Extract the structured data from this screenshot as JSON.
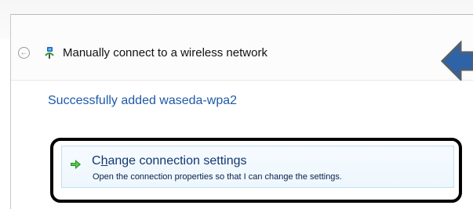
{
  "window": {
    "title": "Manually connect to a wireless network"
  },
  "icons": {
    "back": "back-arrow-icon",
    "network": "wireless-network-icon",
    "pointer": "blue-arrow-icon",
    "command": "green-arrow-icon"
  },
  "content": {
    "success_message": "Successfully added waseda-wpa2"
  },
  "command_link": {
    "title_prefix": "C",
    "title_mnemonic": "h",
    "title_suffix": "ange connection settings",
    "description": "Open the connection properties so that I can change the settings."
  },
  "colors": {
    "success_text": "#1e5aa7",
    "link_title": "#12376f",
    "highlight_border": "#000000",
    "pointer_arrow": "#2f63a7",
    "command_arrow": "#2f8a2f"
  }
}
